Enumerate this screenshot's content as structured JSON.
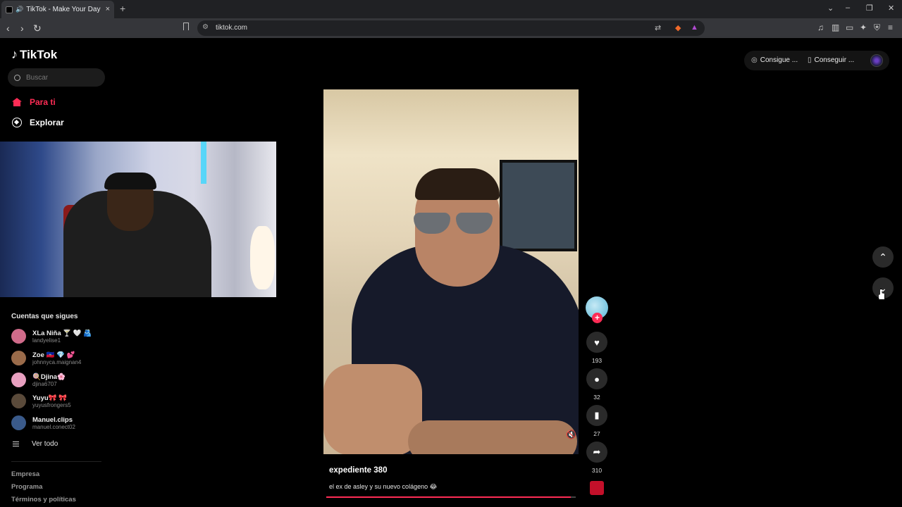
{
  "browser": {
    "tab_title": "TikTok - Make Your Day",
    "url": "tiktok.com",
    "tab_close": "×",
    "new_tab": "+"
  },
  "tiktok": {
    "logo": "TikTok",
    "search_placeholder": "Buscar",
    "nav": [
      {
        "label": "Para ti"
      },
      {
        "label": "Explorar"
      }
    ],
    "following_title": "Cuentas que sigues",
    "accounts": [
      {
        "name": "XLa Niña 🍸 🤍 🫂",
        "handle": "landyelise1",
        "color": "#d06b8a"
      },
      {
        "name": "Zoe 🇭🇹 💎 💕",
        "handle": "johnnyca.maignan4",
        "color": "#9a6b4a"
      },
      {
        "name": "🍭Djina🌸",
        "handle": "djina6707",
        "color": "#e8a0c0"
      },
      {
        "name": "Yuyu🎀 🎀",
        "handle": "yuyusfrongers5",
        "color": "#5a4a3a"
      },
      {
        "name": "Manuel.clips",
        "handle": "manuel.conect02",
        "color": "#3a5a8a"
      }
    ],
    "see_all": "Ver todo",
    "footer": [
      "Empresa",
      "Programa",
      "Términos y políticas"
    ],
    "top_right": {
      "coins": "Consigue ...",
      "app": "Conseguir ..."
    },
    "video": {
      "title": "expediente 380",
      "description": "el ex de asley y su nuevo colágeno 😂",
      "progress": 0.98
    },
    "actions": {
      "likes": "193",
      "comments": "32",
      "saves": "27",
      "shares": "310"
    }
  },
  "colors": {
    "accent": "#fe2c55"
  }
}
